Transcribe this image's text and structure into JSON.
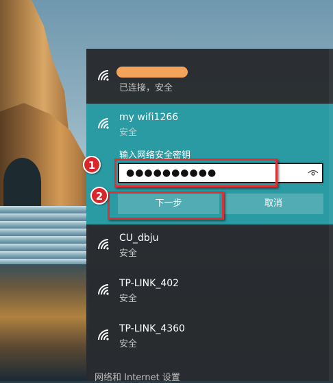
{
  "networks": [
    {
      "name": "",
      "status": "已连接，安全",
      "icon": "wifi-icon"
    },
    {
      "name": "my wifi1266",
      "status": "安全",
      "icon": "wifi-icon"
    },
    {
      "name": "CU_dbju",
      "status": "安全",
      "icon": "wifi-icon"
    },
    {
      "name": "TP-LINK_402",
      "status": "安全",
      "icon": "wifi-icon"
    },
    {
      "name": "TP-LINK_4360",
      "status": "安全",
      "icon": "wifi-icon"
    }
  ],
  "password_panel": {
    "label": "输入网络安全密钥",
    "value_masked": "●●●●●●●●●●",
    "reveal_icon": "eye-icon",
    "next_label": "下一步",
    "cancel_label": "取消"
  },
  "annotations": {
    "step1": "1",
    "step2": "2"
  },
  "footer": {
    "settings_link": "网络和 Internet 设置"
  },
  "colors": {
    "accent": "#2b9ba3",
    "annotation_red": "#d9262b",
    "mask_orange": "#f3a45a"
  }
}
